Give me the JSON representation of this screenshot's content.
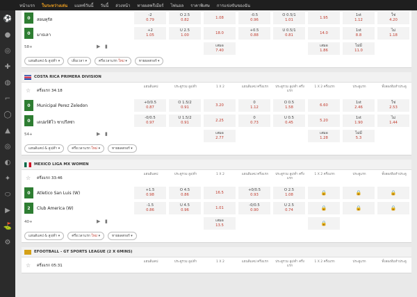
{
  "nav": [
    "หน้าแรก",
    "ในระหว่างเล่น",
    "แมทช์วันนี้",
    "วันนี้",
    "ล่วงหน้า",
    "ทายผลพรีเมียร์",
    "ไฟนอล",
    "ราคาพิเศษ",
    "การแข่งขันของฉัน"
  ],
  "sidebar_icons": [
    "soccer-ball-icon",
    "basketball-icon",
    "tennis-icon",
    "badminton-icon",
    "volleyball-icon",
    "hockey-stick-icon",
    "baseball-icon",
    "cricket-icon",
    "darts-icon",
    "table-tennis-icon",
    "mma-icon",
    "rugby-icon",
    "esports-icon",
    "golf-icon",
    "cycling-icon"
  ],
  "m0": {
    "r1": {
      "score": "0",
      "team": "สอนทุรัส",
      "c1": [
        "-2",
        "0.79"
      ],
      "c2": [
        "O 2.5",
        "0.82"
      ],
      "c3": [
        "",
        "1.08"
      ],
      "c4": [
        "-0.5",
        "0.96"
      ],
      "c5": [
        "O 0.5/1",
        "1.01"
      ],
      "c6": [
        "",
        "1.95"
      ],
      "c7": [
        "1st",
        "1.12"
      ],
      "c8": [
        "ใช่",
        "4.20"
      ]
    },
    "r2": {
      "score": "0",
      "team": "มาธเลา",
      "c1": [
        "+2",
        "1.05"
      ],
      "c2": [
        "U 2.5",
        "1.00"
      ],
      "c3": [
        "",
        "18.0"
      ],
      "c4": [
        "+0.5",
        "0.88"
      ],
      "c5": [
        "U 0.5/1",
        "0.81"
      ],
      "c6": [
        "",
        "14.0"
      ],
      "c7": [
        "1st",
        "8.8"
      ],
      "c8": [
        "ไม่",
        "1.18"
      ]
    },
    "extra": {
      "count": "58+",
      "c3": [
        "เสมอ",
        "7.40"
      ],
      "c6": [
        "เสมอ",
        "1.86"
      ],
      "c7": [
        "ไม่มี",
        "11.0"
      ]
    }
  },
  "filters1": [
    "แฮนดิแคป & สูง/ต่ำ ▾",
    "เต็มเวลา ▾",
    "ครึ่งเวลาแรก ใหม่ ▾",
    "ทายผลสกอร์ ▾"
  ],
  "league1": {
    "name": "COSTA RICA PRIMERA DIVISION",
    "time": "ครึ่งแรก 34:18"
  },
  "headers": [
    "แฮนดิแคป",
    "ประตูรวม สูง/ต่ำ",
    "1 X 2",
    "แฮนดิแคป ครึ่งแรก",
    "ประตูรวม สูง/ต่ำ ครึ่งแรก",
    "1 X 2 ครึ่งแรก",
    "ประตูแรก",
    "ทั้งสองทีมทำประตู"
  ],
  "m1": {
    "r1": {
      "score": "0",
      "team": "Municipal Perez Zeledon",
      "c1": [
        "+0/0.5",
        "0.87"
      ],
      "c2": [
        "O 1.5/2",
        "0.91"
      ],
      "c3": [
        "",
        "3.20"
      ],
      "c4": [
        "0",
        "1.12"
      ],
      "c5": [
        "O 0.5",
        "1.58"
      ],
      "c6": [
        "",
        "6.60"
      ],
      "c7": [
        "1st",
        "2.46"
      ],
      "c8": [
        "ใช่",
        "2.53"
      ]
    },
    "r2": {
      "score": "0",
      "team": "เดปอร์ติโว ซาปรีสซ่า",
      "c1": [
        "-0/0.5",
        "0.97"
      ],
      "c2": [
        "U 1.5/2",
        "0.91"
      ],
      "c3": [
        "",
        "2.25"
      ],
      "c4": [
        "0",
        "0.73"
      ],
      "c5": [
        "U 0.5",
        "0.45"
      ],
      "c6": [
        "",
        "5.20"
      ],
      "c7": [
        "1st",
        "1.90"
      ],
      "c8": [
        "ไม่",
        "1.44"
      ]
    },
    "extra": {
      "count": "54+",
      "c3": [
        "เสมอ",
        "2.77"
      ],
      "c6": [
        "เสมอ",
        "1.28"
      ],
      "c7": [
        "ไม่มี",
        "5.3"
      ]
    }
  },
  "filters2": [
    "แฮนดิแคป & สูง/ต่ำ ▾",
    "ครึ่งเวลาแรก ใหม่ ▾",
    "ทายผลสกอร์ ▾"
  ],
  "league2": {
    "name": "MEXICO LIGA MX WOMEN",
    "time": "ครึ่งแรก 33:46"
  },
  "m2": {
    "r1": {
      "score": "0",
      "team": "Atletico San Luis (W)",
      "c1": [
        "+1.5",
        "0.98"
      ],
      "c2": [
        "O 4.5",
        "0.86"
      ],
      "c3": [
        "",
        "16.5"
      ],
      "c4": [
        "+0/0.5",
        "0.93"
      ],
      "c5": [
        "O 2.5",
        "1.08"
      ],
      "c6": [
        "",
        "🔒"
      ],
      "c7": [
        "",
        "🔒"
      ],
      "c8": [
        "",
        "🔒"
      ]
    },
    "r2": {
      "score": "2",
      "team": "Club America (W)",
      "c1": [
        "-1.5",
        "0.86"
      ],
      "c2": [
        "U 4.5",
        "0.96"
      ],
      "c3": [
        "",
        "1.01"
      ],
      "c4": [
        "-0/0.5",
        "0.90"
      ],
      "c5": [
        "U 2.5",
        "0.74"
      ],
      "c6": [
        "",
        "🔒"
      ],
      "c7": [
        "",
        "🔒"
      ],
      "c8": [
        "",
        "🔒"
      ]
    },
    "extra": {
      "count": "40+",
      "c3": [
        "เสมอ",
        "13.5"
      ],
      "c6": [
        "",
        "🔒"
      ]
    }
  },
  "filters3": [
    "แฮนดิแคป & สูง/ต่ำ ▾",
    "ครึ่งเวลาแรก ใหม่ ▾",
    "ทายผลสกอร์ ▾"
  ],
  "league3": {
    "name": "EFOOTBALL - GT SPORTS LEAGUE (2 X 6MINS)",
    "time": "ครึ่งแรก 05:31"
  }
}
